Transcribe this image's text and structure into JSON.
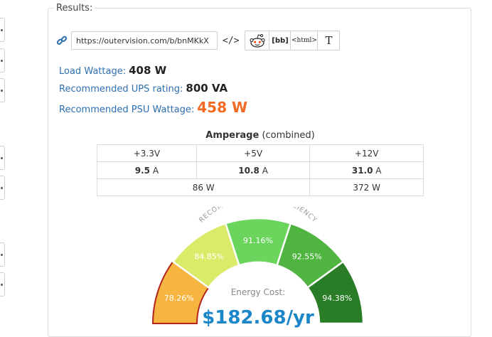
{
  "results": {
    "legend": "Results:",
    "share": {
      "url": "https://outervision.com/b/bnMKkX",
      "embed_icon": "</>",
      "bbcode_label": "[bb]",
      "html_label": "<html>",
      "text_label": "T"
    },
    "load_wattage": {
      "label": "Load Wattage:",
      "value": "408 W"
    },
    "ups_rating": {
      "label": "Recommended UPS rating:",
      "value": "800 VA"
    },
    "psu_wattage": {
      "label": "Recommended PSU Wattage:",
      "value": "458 W"
    },
    "amperage": {
      "title": "Amperage",
      "subtitle": "(combined)",
      "columns": [
        "+3.3V",
        "+5V",
        "+12V"
      ],
      "amps": [
        {
          "value": "9.5",
          "unit": "A"
        },
        {
          "value": "10.8",
          "unit": "A"
        },
        {
          "value": "31.0",
          "unit": "A"
        }
      ],
      "combined_low": "86 W",
      "combined_high": "372 W"
    },
    "gauge": {
      "title": "RECOMMENDED PSU EFFICIENCY",
      "segments": [
        {
          "label": "78.26%",
          "color": "#f6b540"
        },
        {
          "label": "84.85%",
          "color": "#dcea6a"
        },
        {
          "label": "91.16%",
          "color": "#6bd45d"
        },
        {
          "label": "92.55%",
          "color": "#4fb440"
        },
        {
          "label": "94.38%",
          "color": "#2a7d27"
        }
      ],
      "energy_label": "Energy Cost:",
      "energy_value": "$182.68/yr",
      "energy_color": "#1b87c9"
    }
  }
}
